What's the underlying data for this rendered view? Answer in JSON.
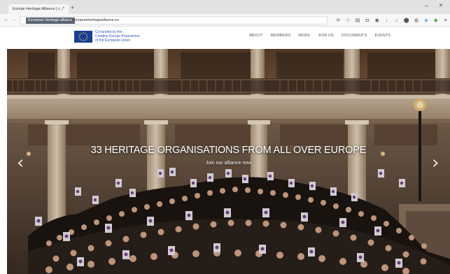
{
  "browser": {
    "tab_title": "Europe Heritage Alliance | c...",
    "tab_close": "×",
    "new_tab": "+",
    "minimize": "–",
    "close": "✕",
    "back": "←",
    "forward": "→",
    "url_selected": "European Heritage alliance",
    "url": "europeanheritagealliance.eu"
  },
  "site": {
    "funded_line1": "Co-funded by the",
    "funded_line2": "Creative Europe Programme",
    "funded_line3": "of the European Union",
    "nav": [
      "ABOUT",
      "MEMBERS",
      "NEWS",
      "JOIN US",
      "DOCUMENTS",
      "EVENTS"
    ]
  },
  "hero": {
    "title": "33 HERITAGE ORGANISATIONS FROM ALL OVER EUROPE",
    "subtitle": "Join our alliance now",
    "prev": "‹",
    "next": "›"
  },
  "colors": {
    "eu_blue": "#1a3e96",
    "eu_star": "#f7d417",
    "link_blue": "#2b5bb5"
  }
}
